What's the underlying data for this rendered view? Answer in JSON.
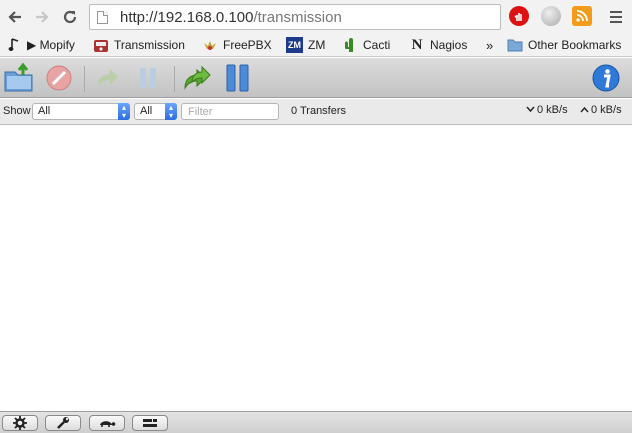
{
  "browser": {
    "url_host": "http://192.168.0.100",
    "url_path": "/transmission",
    "back_icon": "arrow-left-icon",
    "forward_icon": "arrow-right-icon",
    "reload_icon": "reload-icon",
    "extensions": [
      "adblock-icon",
      "globe-icon",
      "rss-icon",
      "menu-icon"
    ]
  },
  "bookmarks": {
    "items": [
      {
        "label": "▶ Mopify",
        "icon": "music-note-icon"
      },
      {
        "label": "Transmission",
        "icon": "transmission-icon"
      },
      {
        "label": "FreePBX",
        "icon": "freepbx-icon"
      },
      {
        "label": "ZM",
        "icon": "zm-icon"
      },
      {
        "label": "Cacti",
        "icon": "cacti-icon"
      },
      {
        "label": "Nagios",
        "icon": "nagios-icon"
      }
    ],
    "overflow": "»",
    "other": "Other Bookmarks"
  },
  "toolbar": {
    "buttons": [
      "open-torrent-icon",
      "remove-torrent-icon",
      "resume-icon",
      "pause-icon",
      "resume-all-icon",
      "pause-all-icon",
      "inspector-icon"
    ]
  },
  "filterbar": {
    "show_label": "Show",
    "state_filter": "All",
    "tracker_filter": "All",
    "filter_placeholder": "Filter",
    "transfer_count": "0 Transfers",
    "download_speed": "0 kB/s",
    "upload_speed": "0 kB/s"
  },
  "bottombar": {
    "buttons": [
      "settings-gear-icon",
      "preferences-wrench-icon",
      "turtle-speed-icon",
      "compact-view-icon"
    ]
  },
  "colors": {
    "accent": "#2a6de0",
    "toolbar_top": "#dcdcdc",
    "toolbar_bottom": "#c2c2c2"
  }
}
